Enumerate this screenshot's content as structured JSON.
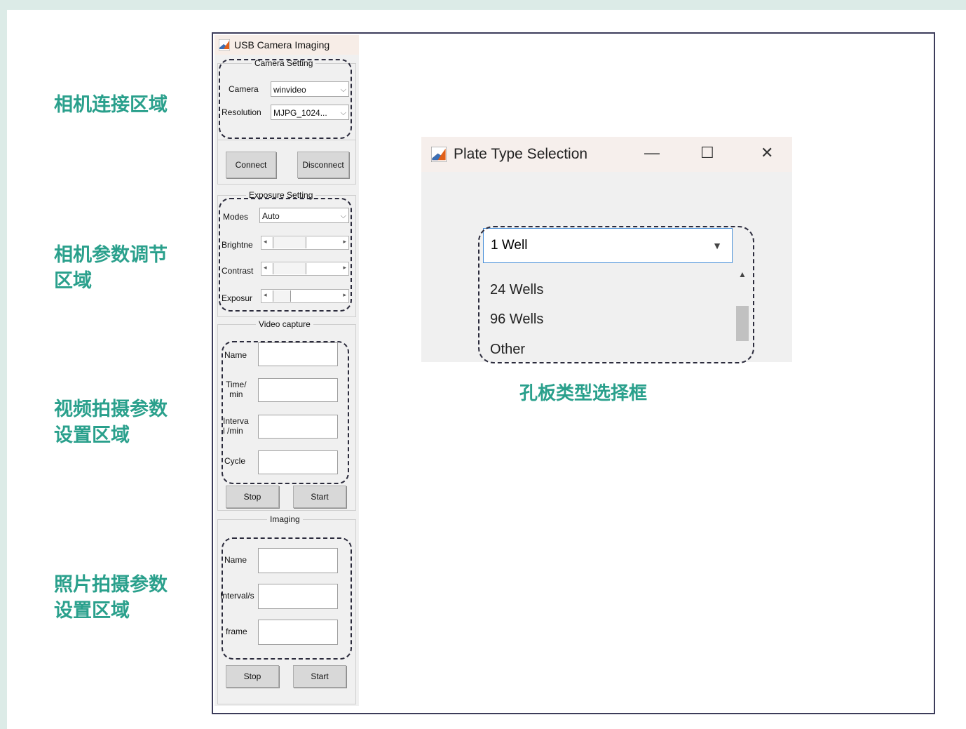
{
  "side_labels": [
    "相机连接区域",
    "相机参数调节\n区域",
    "视频拍摄参数\n设置区域",
    "照片拍摄参数\n设置区域"
  ],
  "usb_window": {
    "title": "USB Camera Imaging",
    "camera_setting": {
      "title": "Camera Setting",
      "camera_label": "Camera",
      "camera_value": "winvideo",
      "resolution_label": "Resolution",
      "resolution_value": "MJPG_1024...",
      "connect": "Connect",
      "disconnect": "Disconnect"
    },
    "exposure_setting": {
      "title": "Exposure Setting",
      "modes_label": "Modes",
      "modes_value": "Auto",
      "brightness_label": "Brightne",
      "contrast_label": "Contrast",
      "exposure_label": "Exposur"
    },
    "video_capture": {
      "title": "Video capture",
      "name_label": "Name",
      "time_label": "Time/\nmin",
      "interval_label": "Interva\nl /min",
      "cycle_label": "Cycle",
      "stop": "Stop",
      "start": "Start"
    },
    "imaging": {
      "title": "Imaging",
      "name_label": "Name",
      "interval_label": "Interval/s",
      "frame_label": "frame",
      "stop": "Stop",
      "start": "Start"
    }
  },
  "plate_window": {
    "title": "Plate Type Selection",
    "minimize": "—",
    "maximize": "☐",
    "close": "✕",
    "selected": "1 Well",
    "options": [
      "24 Wells",
      "96 Wells",
      "Other"
    ]
  },
  "caption": "孔板类型选择框",
  "colors": {
    "accent_green": "#2aa08c",
    "frame": "#dcebe7"
  }
}
